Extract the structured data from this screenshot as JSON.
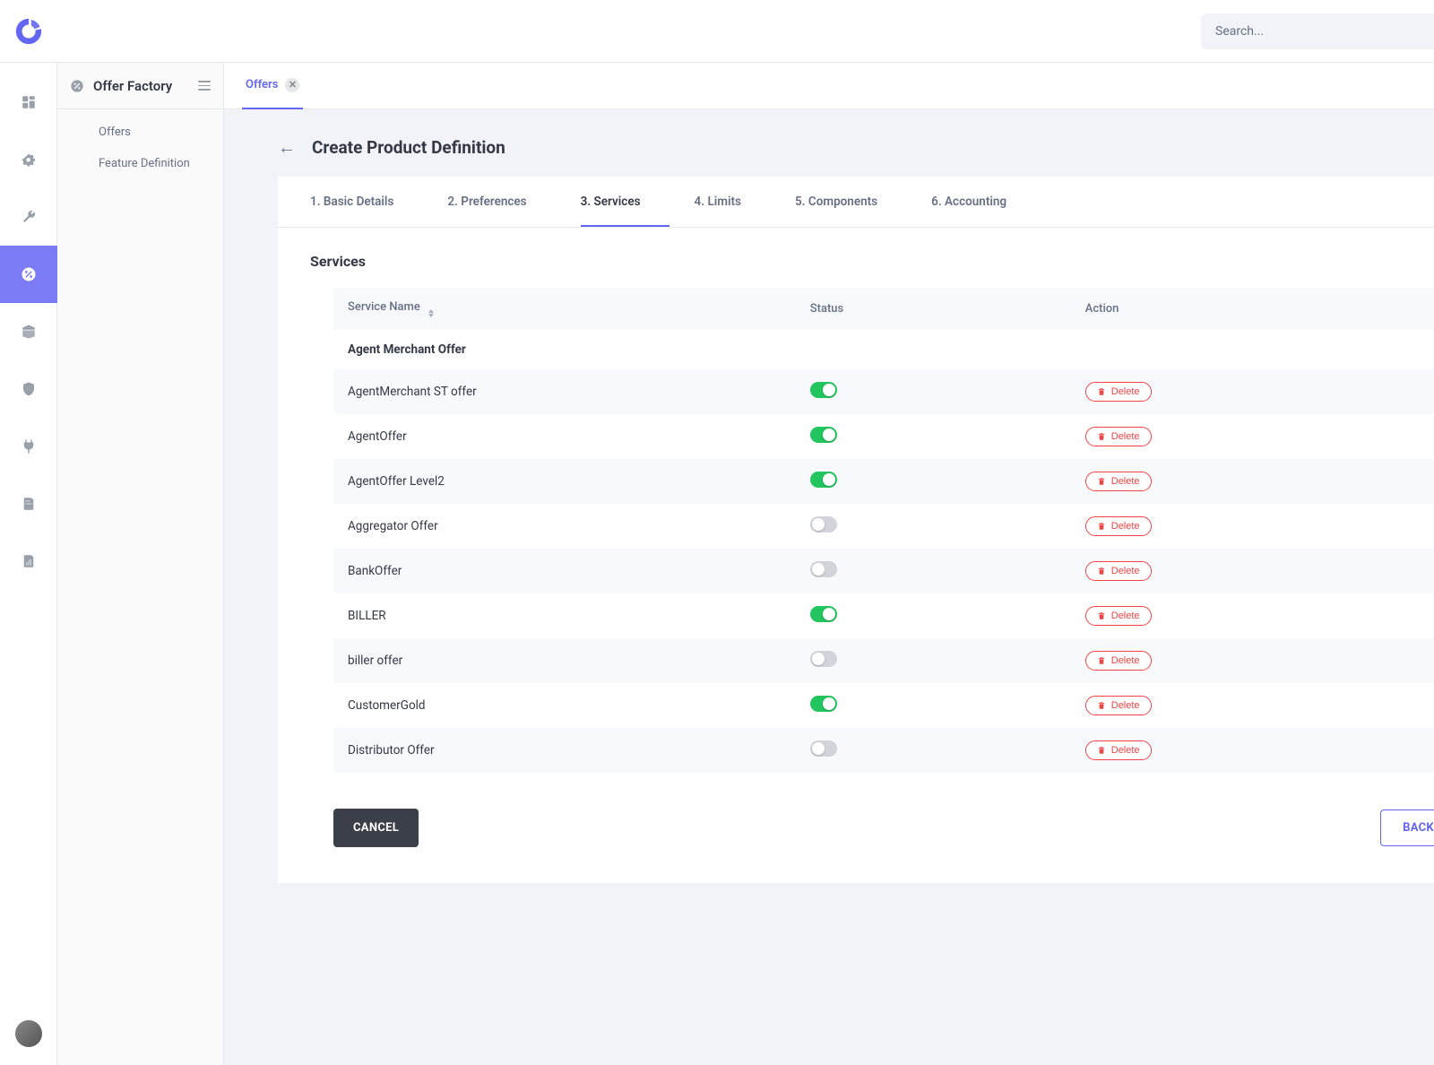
{
  "app": {
    "search_placeholder": "Search..."
  },
  "sidepanel": {
    "title": "Offer Factory",
    "items": [
      "Offers",
      "Feature Definition"
    ]
  },
  "tab": {
    "label": "Offers"
  },
  "page": {
    "title": "Create Product Definition"
  },
  "steps": [
    {
      "label": "1. Basic Details",
      "active": false
    },
    {
      "label": "2. Preferences",
      "active": false
    },
    {
      "label": "3. Services",
      "active": true
    },
    {
      "label": "4. Limits",
      "active": false
    },
    {
      "label": "5. Components",
      "active": false
    },
    {
      "label": "6. Accounting",
      "active": false
    }
  ],
  "section": {
    "title": "Services"
  },
  "table": {
    "columns": {
      "name": "Service Name",
      "status": "Status",
      "action": "Action"
    },
    "delete_label": "Delete",
    "rows": [
      {
        "type": "group",
        "name": "Agent Merchant Offer"
      },
      {
        "type": "row",
        "name": "AgentMerchant ST offer",
        "status": true
      },
      {
        "type": "row",
        "name": "AgentOffer",
        "status": true
      },
      {
        "type": "row",
        "name": "AgentOffer Level2",
        "status": true
      },
      {
        "type": "row",
        "name": "Aggregator Offer",
        "status": false
      },
      {
        "type": "row",
        "name": "BankOffer",
        "status": false
      },
      {
        "type": "row",
        "name": "BILLER",
        "status": true
      },
      {
        "type": "row",
        "name": "biller offer",
        "status": false
      },
      {
        "type": "row",
        "name": "CustomerGold",
        "status": true
      },
      {
        "type": "row",
        "name": "Distributor Offer",
        "status": false
      }
    ]
  },
  "footer": {
    "cancel": "CANCEL",
    "back": "BACK"
  }
}
